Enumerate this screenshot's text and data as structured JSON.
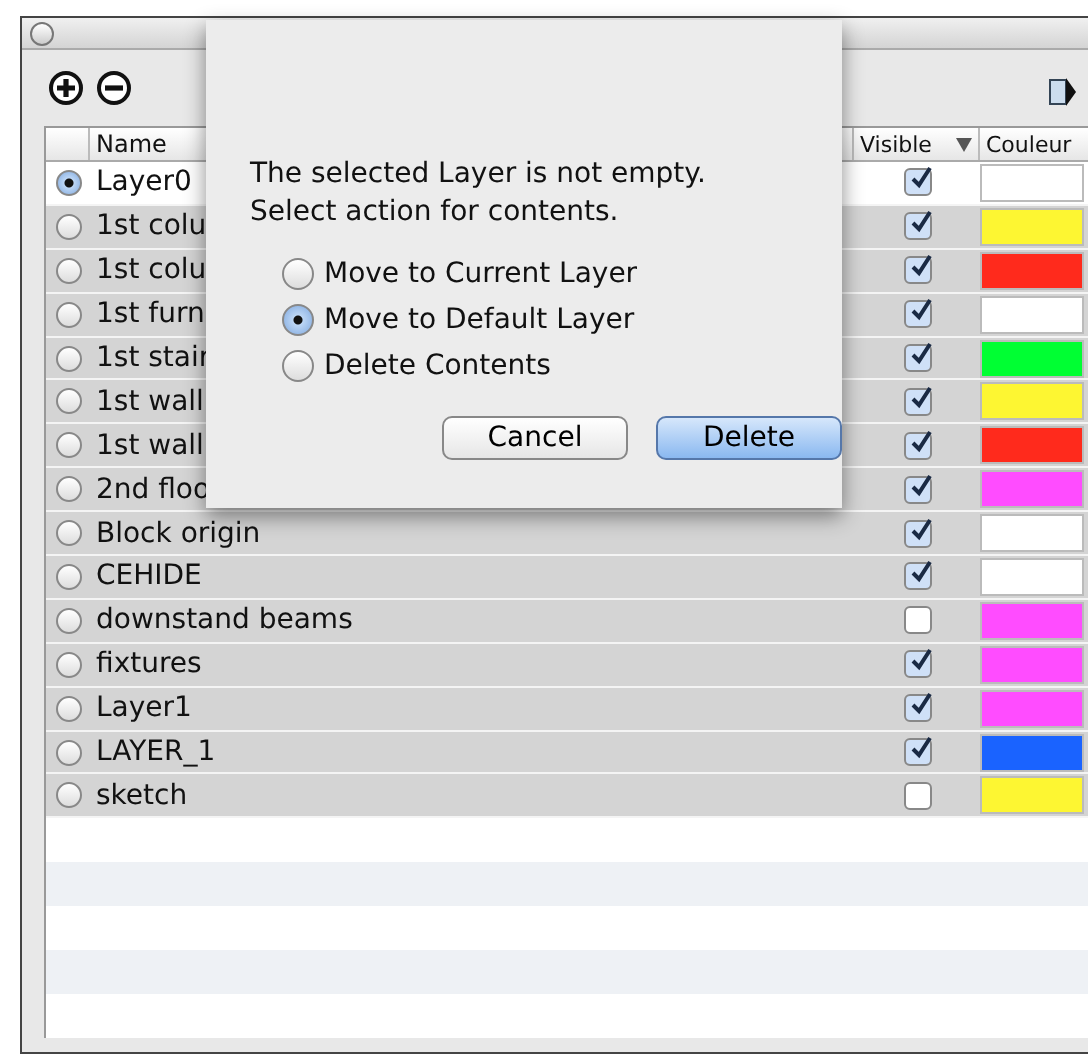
{
  "table": {
    "columns": [
      "Name",
      "Visible",
      "Couleur"
    ],
    "rows": [
      {
        "name": "Layer0",
        "selected": true,
        "visible": true,
        "color": "#ffffff"
      },
      {
        "name": "1st colu",
        "selected": false,
        "visible": true,
        "color": "#fdf632"
      },
      {
        "name": "1st colu",
        "selected": false,
        "visible": true,
        "color": "#ff2a1c"
      },
      {
        "name": "1st furn",
        "selected": false,
        "visible": true,
        "color": "#ffffff"
      },
      {
        "name": "1st stair",
        "selected": false,
        "visible": true,
        "color": "#00ff33"
      },
      {
        "name": "1st wall",
        "selected": false,
        "visible": true,
        "color": "#fdf632"
      },
      {
        "name": "1st wall",
        "selected": false,
        "visible": true,
        "color": "#ff2a1c"
      },
      {
        "name": "2nd floo",
        "selected": false,
        "visible": true,
        "color": "#ff4cff"
      },
      {
        "name": "Block origin",
        "selected": false,
        "visible": true,
        "color": "#ffffff"
      },
      {
        "name": "CEHIDE",
        "selected": false,
        "visible": true,
        "color": "#ffffff"
      },
      {
        "name": "downstand beams",
        "selected": false,
        "visible": false,
        "color": "#ff4cff"
      },
      {
        "name": "fixtures",
        "selected": false,
        "visible": true,
        "color": "#ff4cff"
      },
      {
        "name": "Layer1",
        "selected": false,
        "visible": true,
        "color": "#ff4cff"
      },
      {
        "name": "LAYER_1",
        "selected": false,
        "visible": true,
        "color": "#1a63ff"
      },
      {
        "name": "sketch",
        "selected": false,
        "visible": false,
        "color": "#fdf632"
      }
    ]
  },
  "dialog": {
    "message": [
      "The selected Layer is not empty.",
      "Select action for contents."
    ],
    "options": [
      {
        "label": "Move to Current Layer",
        "selected": false
      },
      {
        "label": "Move to Default Layer",
        "selected": true
      },
      {
        "label": "Delete Contents",
        "selected": false
      }
    ],
    "buttons": [
      {
        "label": "Cancel",
        "kind": "normal"
      },
      {
        "label": "Delete",
        "kind": "default"
      }
    ]
  }
}
